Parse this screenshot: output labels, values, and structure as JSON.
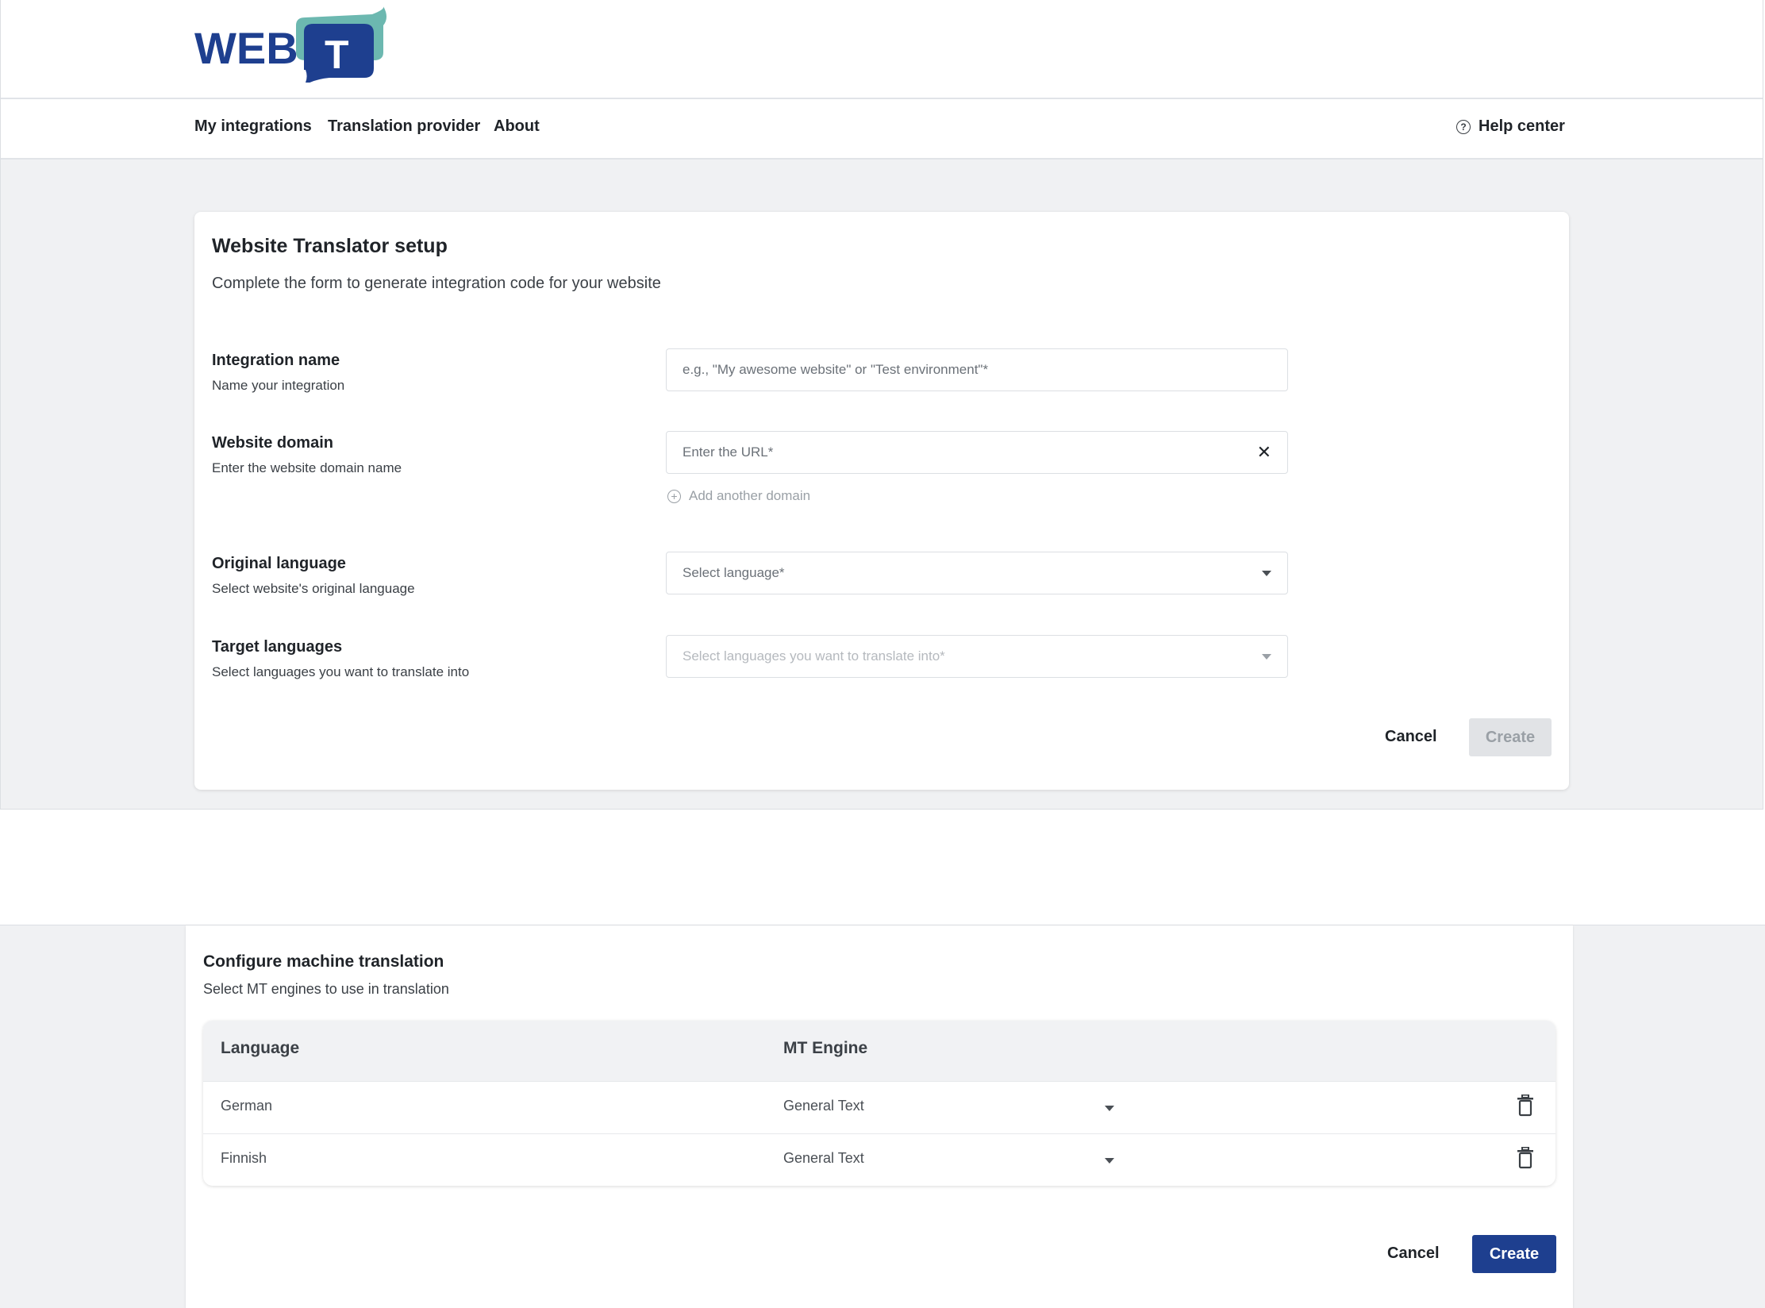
{
  "brand": {
    "logo_text": "WEB",
    "logo_letter": "T",
    "colors": {
      "navy": "#1e3f8f",
      "teal": "#6cb8b0"
    }
  },
  "nav": {
    "links": [
      "My integrations",
      "Translation provider",
      "About"
    ],
    "help": {
      "icon": "help-circle-icon",
      "label": "Help center"
    }
  },
  "setup": {
    "title": "Website Translator setup",
    "subtitle": "Complete the form to generate integration code for your website",
    "fields": {
      "integration_name": {
        "label": "Integration name",
        "hint": "Name your integration",
        "placeholder": "e.g., \"My awesome website\" or \"Test environment\"*"
      },
      "website_domain": {
        "label": "Website domain",
        "hint": "Enter the website domain name",
        "placeholder": "Enter the URL*",
        "add_label": "Add another domain"
      },
      "original_language": {
        "label": "Original language",
        "hint": "Select website's original language",
        "placeholder": "Select language*"
      },
      "target_languages": {
        "label": "Target languages",
        "hint": "Select languages you want to translate into",
        "placeholder": "Select languages you want to translate into*"
      }
    },
    "cancel_label": "Cancel",
    "create_label": "Create"
  },
  "mt": {
    "title": "Configure machine translation",
    "subtitle": "Select MT engines to use in translation",
    "columns": [
      "Language",
      "MT Engine"
    ],
    "rows": [
      {
        "language": "German",
        "engine": "General Text"
      },
      {
        "language": "Finnish",
        "engine": "General Text"
      }
    ],
    "cancel_label": "Cancel",
    "create_label": "Create"
  }
}
